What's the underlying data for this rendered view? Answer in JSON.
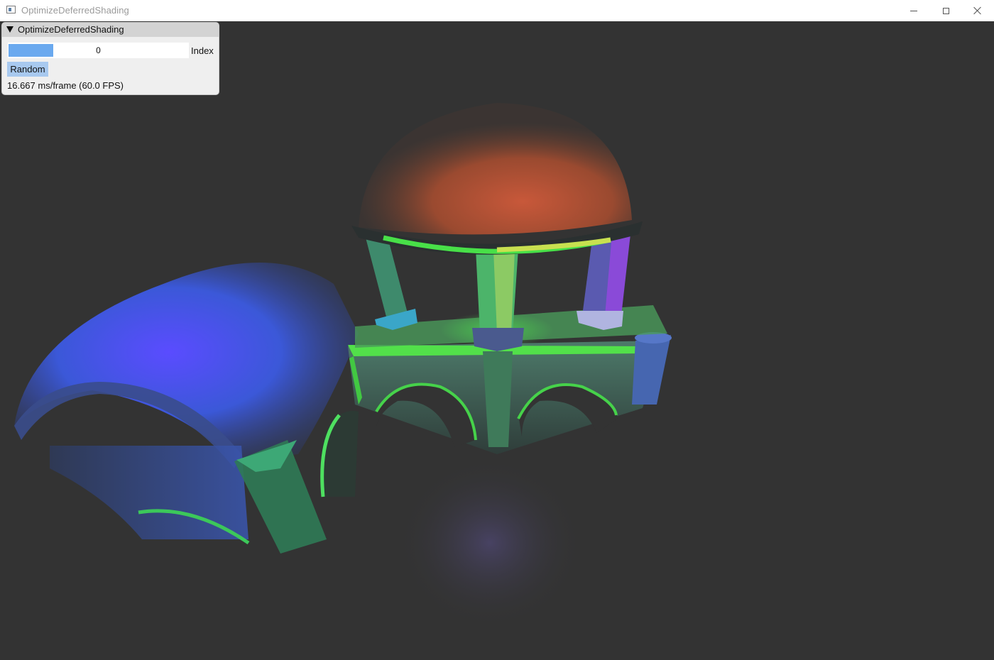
{
  "window": {
    "title": "OptimizeDeferredShading",
    "icon": "app-window-icon",
    "controls": [
      "minimize-icon",
      "maximize-icon",
      "close-icon"
    ]
  },
  "panel": {
    "title": "OptimizeDeferredShading",
    "collapse_icon": "triangle-down-icon",
    "slider": {
      "label": "Index",
      "value": "0"
    },
    "random_button": "Random",
    "fps_text": "16.667 ms/frame (60.0 FPS)"
  },
  "viewport": {
    "background": "#333333",
    "scene": "deferred-shading-3d-scene"
  },
  "colors": {
    "accent": "#6aa9ef",
    "button": "#a8c9ef",
    "panel_bg": "#efefef",
    "panel_header": "#d3d3d3"
  }
}
